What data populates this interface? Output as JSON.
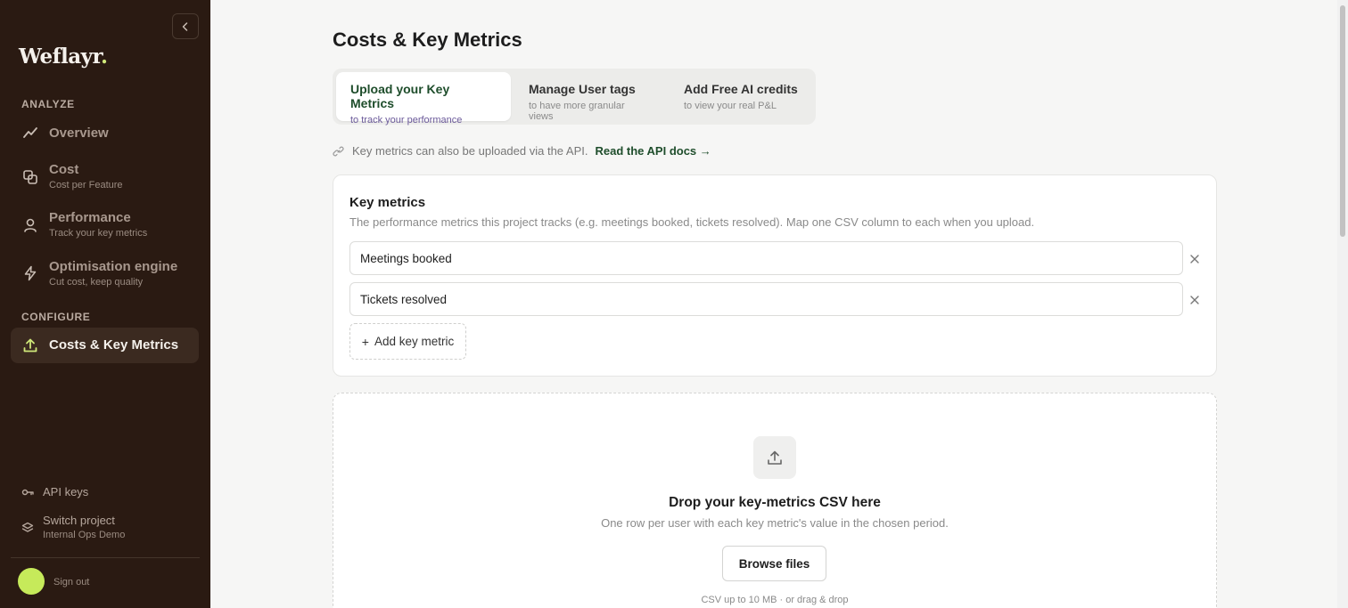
{
  "app": {
    "logo_text": "Weflayr",
    "logo_dot": "."
  },
  "sidebar": {
    "analyze_label": "ANALYZE",
    "configure_label": "CONFIGURE",
    "items": [
      {
        "label": "Overview",
        "sub": "",
        "icon": "trend-line-icon"
      },
      {
        "label": "Cost",
        "sub": "Cost per Feature",
        "icon": "stacked-squares-icon"
      },
      {
        "label": "Performance",
        "sub": "Track your key metrics",
        "icon": "user-icon"
      },
      {
        "label": "Optimisation engine",
        "sub": "Cut cost, keep quality",
        "icon": "lightning-icon"
      },
      {
        "label": "Costs & Key Metrics",
        "sub": "",
        "icon": "upload-icon",
        "active": true
      }
    ],
    "api_keys": "API keys",
    "switch_project": {
      "label": "Switch project",
      "sub": "Internal Ops Demo"
    },
    "sign_out": "Sign out"
  },
  "main": {
    "title": "Costs & Key Metrics",
    "tabs": [
      {
        "label": "Upload your Key Metrics",
        "sub": "to track your performance",
        "active": true
      },
      {
        "label": "Manage User tags",
        "sub": "to have more granular views"
      },
      {
        "label": "Add Free AI credits",
        "sub": "to view your real P&L"
      }
    ],
    "api_note": "Key metrics can also be uploaded via the API.",
    "api_link": "Read the API docs →",
    "card": {
      "title": "Key metrics",
      "description": "The performance metrics this project tracks (e.g. meetings booked, tickets resolved). Map one CSV column to each when you upload.",
      "metrics": [
        "Meetings booked",
        "Tickets resolved"
      ],
      "add_label": "Add key metric"
    },
    "dropzone": {
      "title": "Drop your key-metrics CSV here",
      "subtitle": "One row per user with each key metric's value in the chosen period.",
      "browse_label": "Browse files",
      "footer": "CSV up to 10 MB · or drag & drop"
    }
  },
  "colors": {
    "sidebar_bg": "#2a1a12",
    "accent_green": "#1e4d2b",
    "lime": "#c6ea5a"
  }
}
